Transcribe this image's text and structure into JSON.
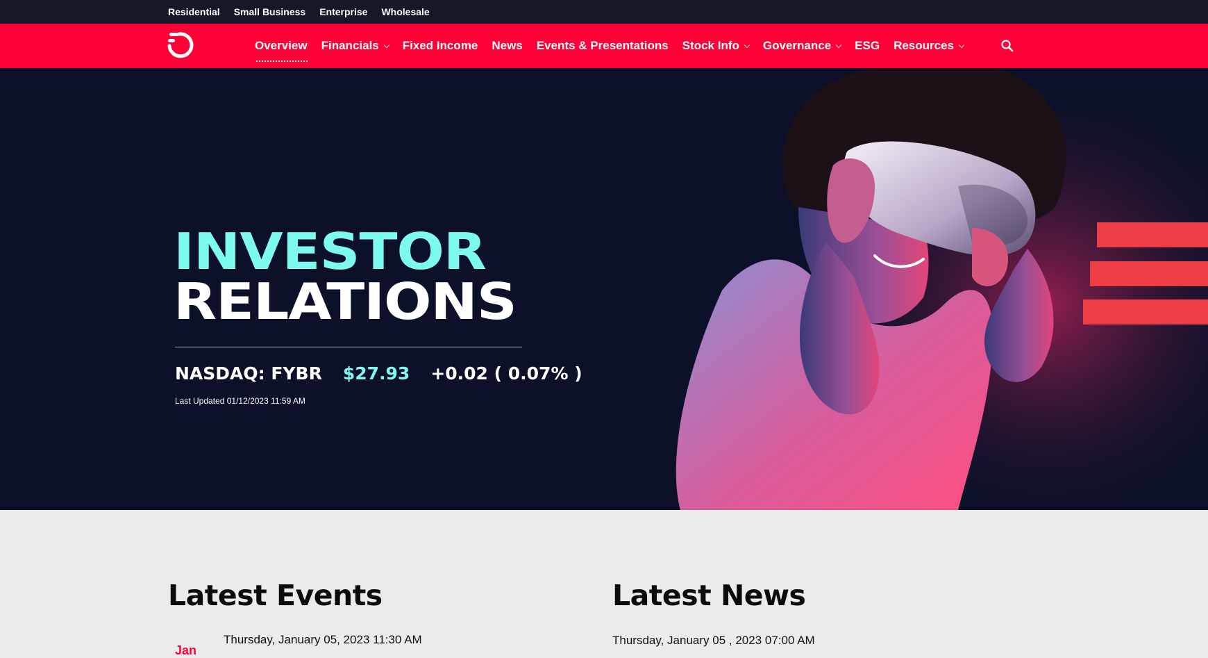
{
  "topbar": {
    "links": [
      "Residential",
      "Small Business",
      "Enterprise",
      "Wholesale"
    ]
  },
  "nav": {
    "logo_icon": "frontier-logo-icon",
    "items": [
      {
        "label": "Overview",
        "active": true,
        "dropdown": false
      },
      {
        "label": "Financials",
        "active": false,
        "dropdown": true
      },
      {
        "label": "Fixed Income",
        "active": false,
        "dropdown": false
      },
      {
        "label": "News",
        "active": false,
        "dropdown": false
      },
      {
        "label": "Events & Presentations",
        "active": false,
        "dropdown": false
      },
      {
        "label": "Stock Info",
        "active": false,
        "dropdown": true
      },
      {
        "label": "Governance",
        "active": false,
        "dropdown": true
      },
      {
        "label": "ESG",
        "active": false,
        "dropdown": false
      },
      {
        "label": "Resources",
        "active": false,
        "dropdown": true
      }
    ],
    "search_icon": "search-icon"
  },
  "hero": {
    "title_line1": "INVESTOR",
    "title_line2": "RELATIONS",
    "ticker": "NASDAQ: FYBR",
    "price": "$27.93",
    "change": "+0.02 ( 0.07% )",
    "last_updated": "Last Updated 01/12/2023 11:59 AM"
  },
  "events": {
    "heading": "Latest Events",
    "first_date": "Thursday, January 05, 2023 11:30 AM",
    "first_month": "Jan"
  },
  "news": {
    "heading": "Latest News",
    "first_date": "Thursday, January 05 , 2023 07:00 AM"
  },
  "colors": {
    "brand_red": "#ff0037",
    "accent_cyan": "#7dfbf0",
    "hero_bg": "#0c1129",
    "topbar_bg": "#141827"
  }
}
